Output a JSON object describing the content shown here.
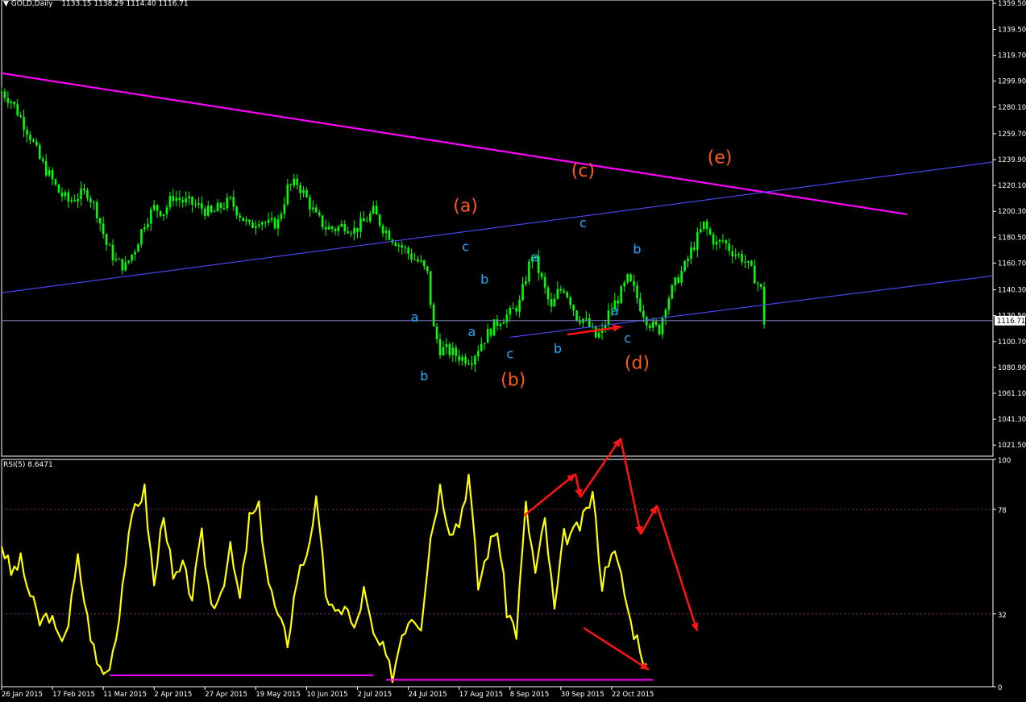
{
  "header": {
    "symbol_timeframe": "GOLD,Daily",
    "ohlc": "1133.15 1138.29 1114.40 1116.71",
    "current_price": "1116.71"
  },
  "rsi_header": {
    "label": "RSI(5) 8.6471"
  },
  "colors": {
    "background": "#000000",
    "candle": "#00ff00",
    "rsi_line": "#ffff00",
    "triangle_upper": "#ff00ff",
    "channel_lines": "#4a4aff",
    "current_price_line": "#8080c0",
    "wave_major": "#ff5a1e",
    "wave_minor": "#22aaff",
    "arrows": "#ff1414",
    "axis_text": "#ffffff",
    "grid": "#8a2a8a"
  },
  "chart_data": [
    {
      "type": "candlestick",
      "name": "price",
      "x": [
        "26 Jan 2015",
        "17 Feb 2015",
        "11 Mar 2015",
        "2 Apr 2015",
        "27 Apr 2015",
        "19 May 2015",
        "10 Jun 2015",
        "2 Jul 2015",
        "24 Jul 2015",
        "17 Aug 2015",
        "8 Sep 2015",
        "30 Sep 2015",
        "22 Oct 2015"
      ],
      "y_ticks": [
        "1359.50",
        "1339.50",
        "1319.70",
        "1299.90",
        "1280.10",
        "1259.70",
        "1239.90",
        "1220.10",
        "1200.30",
        "1180.50",
        "1160.70",
        "1140.30",
        "1120.50",
        "1100.70",
        "1080.90",
        "1061.10",
        "1041.30",
        "1021.50"
      ],
      "ylim": [
        1013,
        1362
      ],
      "close_path": [
        [
          0,
          1292
        ],
        [
          3,
          1285
        ],
        [
          6,
          1272
        ],
        [
          9,
          1258
        ],
        [
          12,
          1240
        ],
        [
          15,
          1228
        ],
        [
          18,
          1215
        ],
        [
          21,
          1208
        ],
        [
          24,
          1212
        ],
        [
          27,
          1215
        ],
        [
          30,
          1200
        ],
        [
          33,
          1175
        ],
        [
          36,
          1162
        ],
        [
          39,
          1158
        ],
        [
          42,
          1172
        ],
        [
          45,
          1192
        ],
        [
          48,
          1203
        ],
        [
          51,
          1200
        ],
        [
          54,
          1212
        ],
        [
          57,
          1208
        ],
        [
          60,
          1206
        ],
        [
          63,
          1203
        ],
        [
          66,
          1198
        ],
        [
          69,
          1204
        ],
        [
          72,
          1208
        ],
        [
          75,
          1198
        ],
        [
          78,
          1188
        ],
        [
          81,
          1195
        ],
        [
          84,
          1190
        ],
        [
          87,
          1192
        ],
        [
          90,
          1218
        ],
        [
          93,
          1222
        ],
        [
          96,
          1210
        ],
        [
          99,
          1196
        ],
        [
          102,
          1188
        ],
        [
          105,
          1187
        ],
        [
          108,
          1190
        ],
        [
          111,
          1186
        ],
        [
          114,
          1192
        ],
        [
          117,
          1200
        ],
        [
          120,
          1188
        ],
        [
          123,
          1180
        ],
        [
          126,
          1173
        ],
        [
          129,
          1166
        ],
        [
          132,
          1160
        ],
        [
          134,
          1152
        ],
        [
          136,
          1110
        ],
        [
          138,
          1095
        ],
        [
          140,
          1094
        ],
        [
          142,
          1092
        ],
        [
          145,
          1088
        ],
        [
          148,
          1088
        ],
        [
          151,
          1100
        ],
        [
          154,
          1110
        ],
        [
          157,
          1118
        ],
        [
          160,
          1122
        ],
        [
          163,
          1130
        ],
        [
          165,
          1150
        ],
        [
          167,
          1168
        ],
        [
          169,
          1155
        ],
        [
          171,
          1140
        ],
        [
          173,
          1125
        ],
        [
          175,
          1138
        ],
        [
          177,
          1142
        ],
        [
          179,
          1132
        ],
        [
          181,
          1120
        ],
        [
          183,
          1118
        ],
        [
          185,
          1112
        ],
        [
          187,
          1104
        ],
        [
          189,
          1108
        ],
        [
          191,
          1122
        ],
        [
          193,
          1130
        ],
        [
          195,
          1138
        ],
        [
          197,
          1148
        ],
        [
          199,
          1140
        ],
        [
          201,
          1128
        ],
        [
          203,
          1118
        ],
        [
          205,
          1112
        ],
        [
          207,
          1110
        ],
        [
          209,
          1130
        ],
        [
          211,
          1140
        ],
        [
          213,
          1150
        ],
        [
          215,
          1158
        ],
        [
          217,
          1170
        ],
        [
          219,
          1180
        ],
        [
          221,
          1190
        ],
        [
          223,
          1182
        ],
        [
          225,
          1175
        ],
        [
          227,
          1178
        ],
        [
          229,
          1172
        ],
        [
          231,
          1168
        ],
        [
          233,
          1165
        ],
        [
          235,
          1158
        ],
        [
          237,
          1150
        ],
        [
          239,
          1140
        ],
        [
          240,
          1116
        ]
      ],
      "x_range": [
        0,
        312
      ]
    },
    {
      "type": "line",
      "name": "RSI(5) 8.6471",
      "y_ticks": [
        "100",
        "78",
        "32",
        "0"
      ],
      "ylim": [
        0,
        100
      ],
      "levels": [
        78,
        32
      ],
      "y_path": [
        [
          0,
          63
        ],
        [
          3,
          50
        ],
        [
          6,
          55
        ],
        [
          9,
          40
        ],
        [
          12,
          28
        ],
        [
          15,
          32
        ],
        [
          18,
          20
        ],
        [
          21,
          28
        ],
        [
          24,
          56
        ],
        [
          27,
          30
        ],
        [
          30,
          10
        ],
        [
          33,
          6
        ],
        [
          36,
          22
        ],
        [
          39,
          56
        ],
        [
          42,
          80
        ],
        [
          45,
          86
        ],
        [
          48,
          44
        ],
        [
          51,
          78
        ],
        [
          54,
          46
        ],
        [
          57,
          52
        ],
        [
          60,
          40
        ],
        [
          63,
          66
        ],
        [
          66,
          36
        ],
        [
          69,
          42
        ],
        [
          72,
          60
        ],
        [
          75,
          38
        ],
        [
          78,
          74
        ],
        [
          81,
          78
        ],
        [
          84,
          46
        ],
        [
          87,
          30
        ],
        [
          90,
          20
        ],
        [
          93,
          48
        ],
        [
          96,
          59
        ],
        [
          99,
          81
        ],
        [
          102,
          42
        ],
        [
          105,
          30
        ],
        [
          108,
          37
        ],
        [
          111,
          24
        ],
        [
          114,
          42
        ],
        [
          117,
          22
        ],
        [
          120,
          16
        ],
        [
          123,
          4
        ],
        [
          126,
          24
        ],
        [
          129,
          32
        ],
        [
          132,
          28
        ],
        [
          135,
          66
        ],
        [
          138,
          88
        ],
        [
          141,
          70
        ],
        [
          144,
          72
        ],
        [
          147,
          93
        ],
        [
          150,
          44
        ],
        [
          153,
          60
        ],
        [
          156,
          70
        ],
        [
          159,
          34
        ],
        [
          162,
          24
        ],
        [
          165,
          79
        ],
        [
          168,
          50
        ],
        [
          171,
          73
        ],
        [
          174,
          33
        ],
        [
          177,
          66
        ],
        [
          180,
          67
        ],
        [
          183,
          73
        ],
        [
          186,
          85
        ],
        [
          189,
          45
        ],
        [
          192,
          62
        ],
        [
          195,
          48
        ],
        [
          198,
          28
        ],
        [
          201,
          18
        ],
        [
          203,
          8
        ]
      ]
    }
  ],
  "annotations": {
    "wave_major": [
      {
        "label": "(a)",
        "x": 146,
        "y": 1200
      },
      {
        "label": "(b)",
        "x": 161,
        "y": 1067
      },
      {
        "label": "(c)",
        "x": 183,
        "y": 1227
      },
      {
        "label": "(d)",
        "x": 200,
        "y": 1080
      },
      {
        "label": "(e)",
        "x": 226,
        "y": 1237
      }
    ],
    "wave_minor": [
      {
        "label": "a",
        "x": 130,
        "y": 1116
      },
      {
        "label": "b",
        "x": 133,
        "y": 1071
      },
      {
        "label": "c",
        "x": 146,
        "y": 1170
      },
      {
        "label": "a",
        "x": 148,
        "y": 1105
      },
      {
        "label": "b",
        "x": 152,
        "y": 1145
      },
      {
        "label": "c",
        "x": 160,
        "y": 1088
      },
      {
        "label": "a",
        "x": 168,
        "y": 1162
      },
      {
        "label": "b",
        "x": 175,
        "y": 1092
      },
      {
        "label": "c",
        "x": 183,
        "y": 1188
      },
      {
        "label": "a",
        "x": 193,
        "y": 1121
      },
      {
        "label": "b",
        "x": 200,
        "y": 1168
      },
      {
        "label": "c",
        "x": 197,
        "y": 1100
      }
    ]
  }
}
